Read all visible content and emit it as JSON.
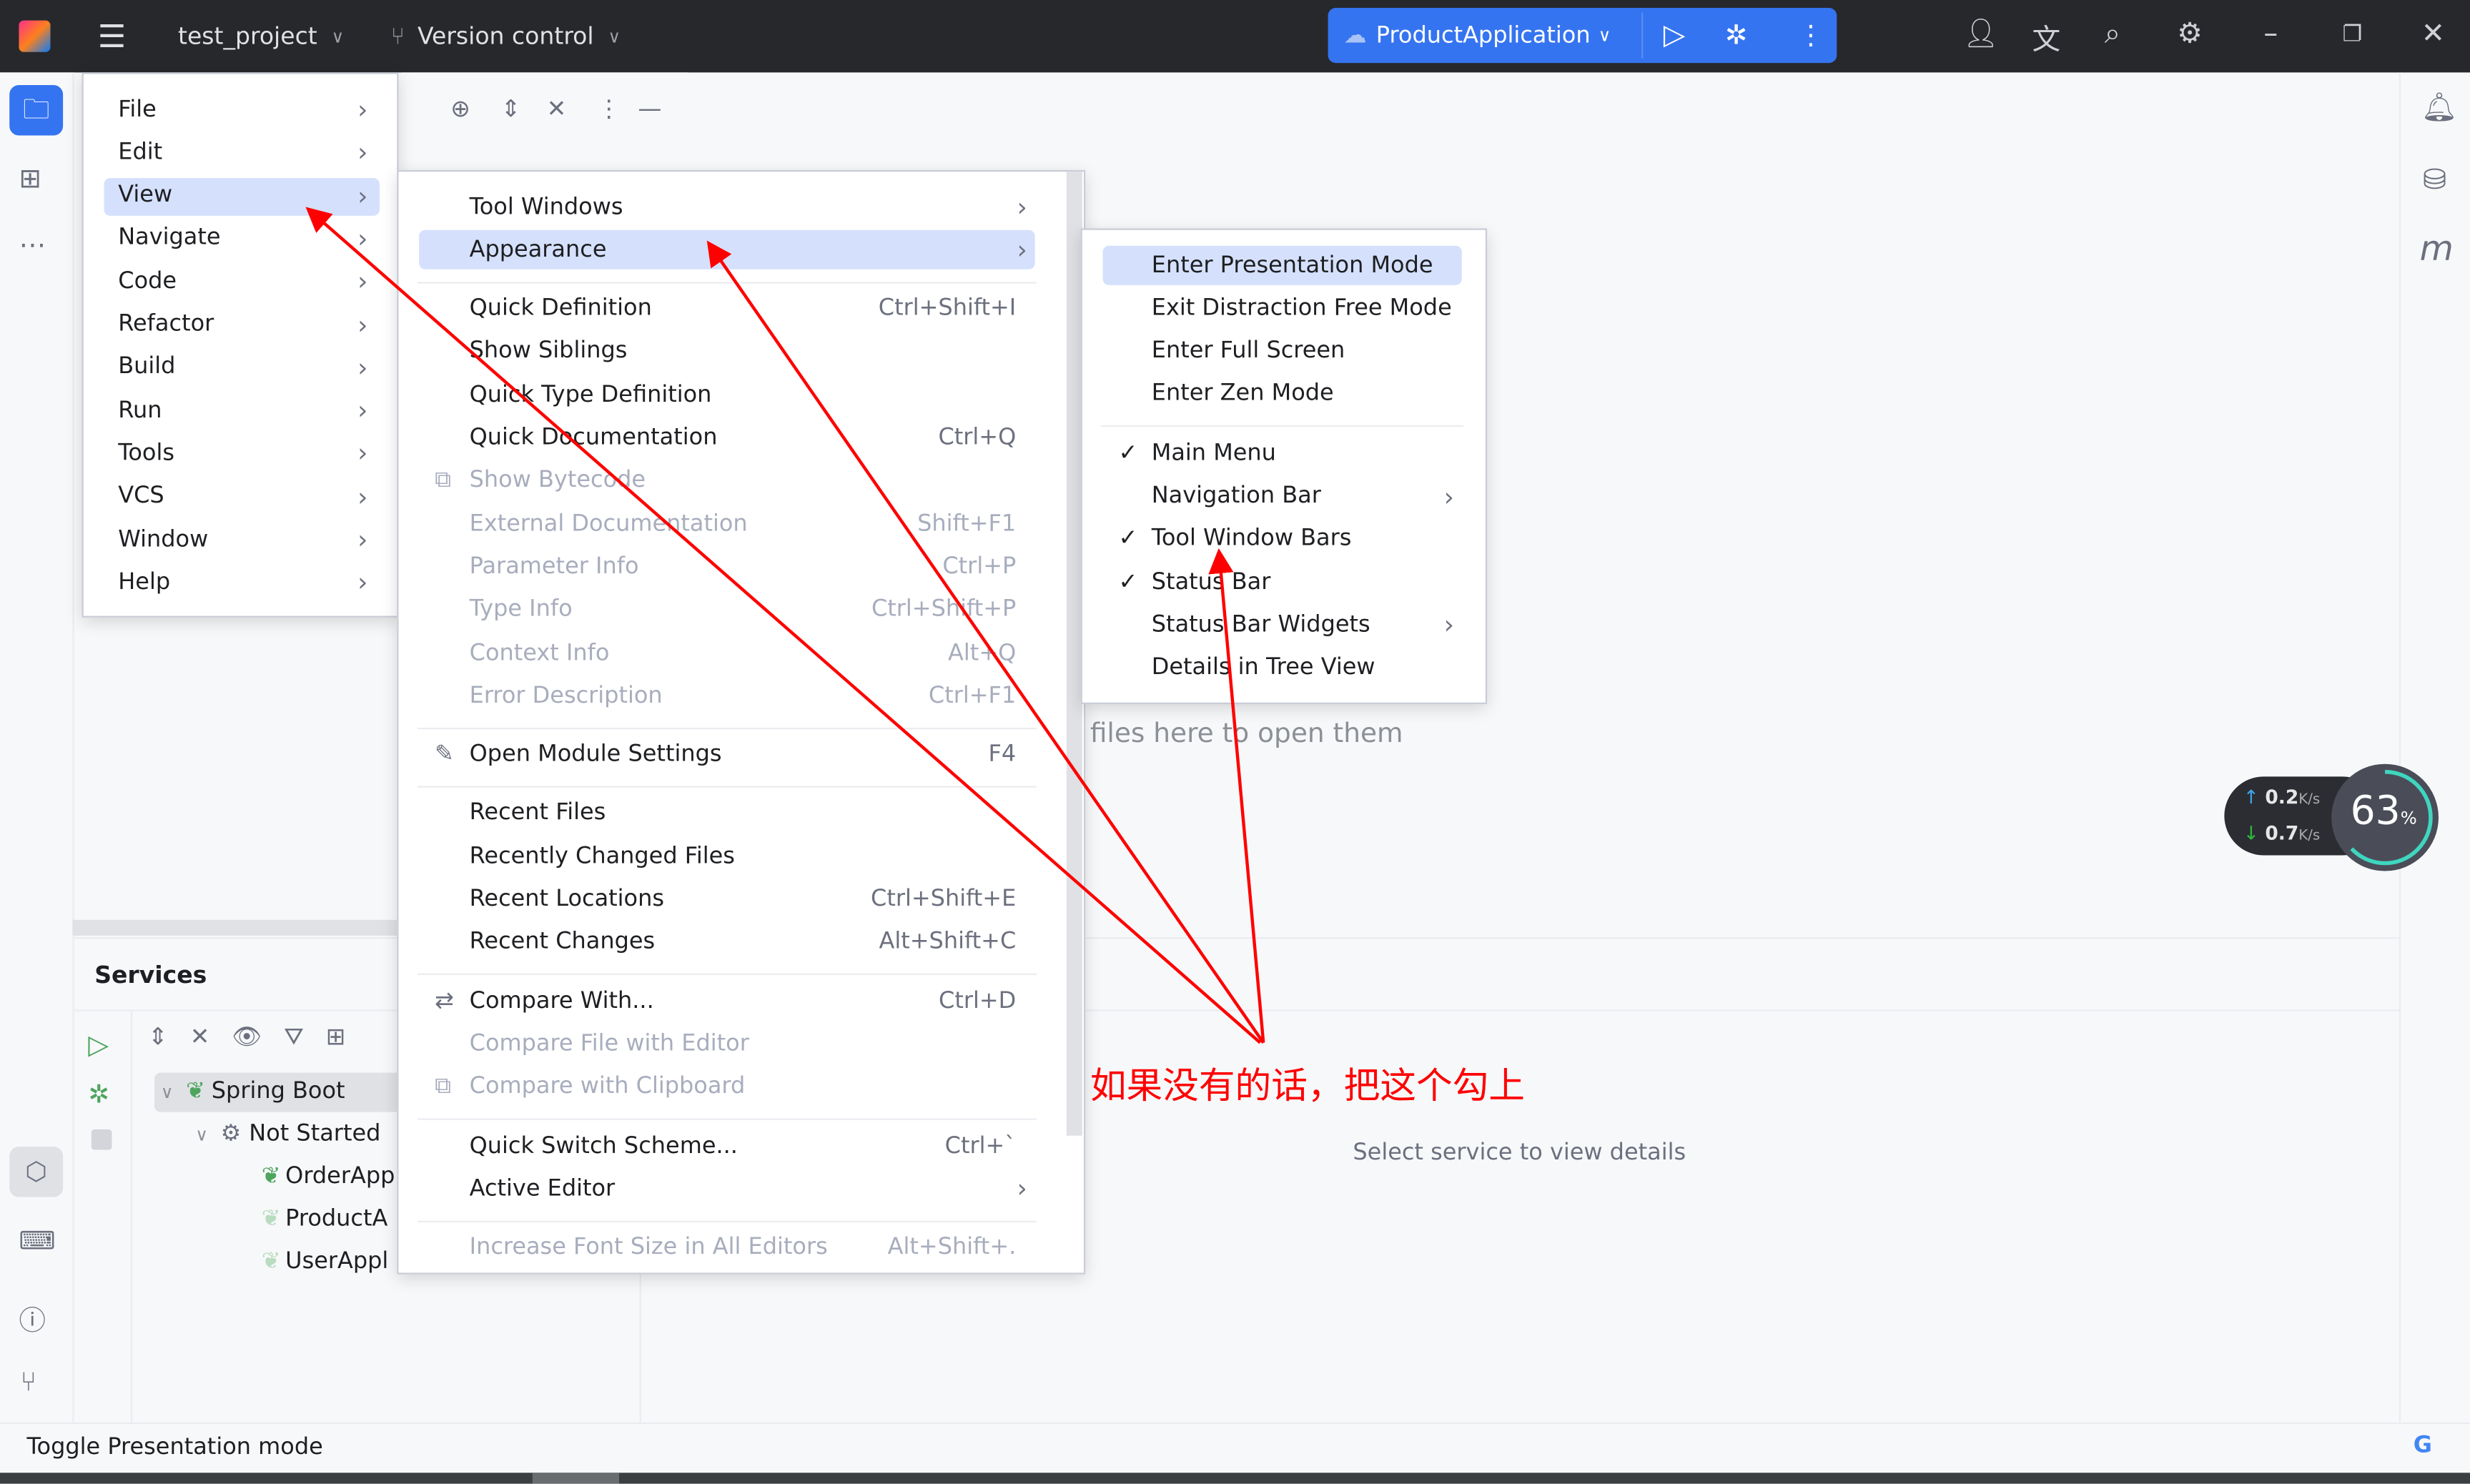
{
  "topbar": {
    "project": "test_project",
    "vcs": "Version control",
    "run_config": "ProductApplication"
  },
  "main_menu": [
    {
      "label": "File"
    },
    {
      "label": "Edit"
    },
    {
      "label": "View",
      "selected": true
    },
    {
      "label": "Navigate"
    },
    {
      "label": "Code"
    },
    {
      "label": "Refactor"
    },
    {
      "label": "Build"
    },
    {
      "label": "Run"
    },
    {
      "label": "Tools"
    },
    {
      "label": "VCS"
    },
    {
      "label": "Window"
    },
    {
      "label": "Help"
    }
  ],
  "view_menu": [
    {
      "label": "Tool Windows",
      "submenu": true
    },
    {
      "label": "Appearance",
      "submenu": true,
      "selected": true
    },
    {
      "sep": true
    },
    {
      "label": "Quick Definition",
      "shortcut": "Ctrl+Shift+I"
    },
    {
      "label": "Show Siblings"
    },
    {
      "label": "Quick Type Definition"
    },
    {
      "label": "Quick Documentation",
      "shortcut": "Ctrl+Q"
    },
    {
      "label": "Show Bytecode",
      "disabled": true,
      "icon": "bytecode-icon"
    },
    {
      "label": "External Documentation",
      "shortcut": "Shift+F1",
      "disabled": true
    },
    {
      "label": "Parameter Info",
      "shortcut": "Ctrl+P",
      "disabled": true
    },
    {
      "label": "Type Info",
      "shortcut": "Ctrl+Shift+P",
      "disabled": true
    },
    {
      "label": "Context Info",
      "shortcut": "Alt+Q",
      "disabled": true
    },
    {
      "label": "Error Description",
      "shortcut": "Ctrl+F1",
      "disabled": true
    },
    {
      "sep": true
    },
    {
      "label": "Open Module Settings",
      "shortcut": "F4",
      "icon": "pencil-icon"
    },
    {
      "sep": true
    },
    {
      "label": "Recent Files"
    },
    {
      "label": "Recently Changed Files"
    },
    {
      "label": "Recent Locations",
      "shortcut": "Ctrl+Shift+E"
    },
    {
      "label": "Recent Changes",
      "shortcut": "Alt+Shift+C"
    },
    {
      "sep": true
    },
    {
      "label": "Compare With...",
      "shortcut": "Ctrl+D",
      "icon": "compare-icon"
    },
    {
      "label": "Compare File with Editor",
      "disabled": true
    },
    {
      "label": "Compare with Clipboard",
      "disabled": true,
      "icon": "clipboard-compare-icon"
    },
    {
      "sep": true
    },
    {
      "label": "Quick Switch Scheme...",
      "shortcut": "Ctrl+`"
    },
    {
      "label": "Active Editor",
      "submenu": true
    },
    {
      "sep": true
    },
    {
      "label": "Increase Font Size in All Editors",
      "shortcut": "Alt+Shift+.",
      "disabled": true
    }
  ],
  "appearance_menu": [
    {
      "label": "Enter Presentation Mode",
      "selected": true
    },
    {
      "label": "Exit Distraction Free Mode"
    },
    {
      "label": "Enter Full Screen"
    },
    {
      "label": "Enter Zen Mode"
    },
    {
      "sep": true
    },
    {
      "label": "Main Menu",
      "checked": true
    },
    {
      "label": "Navigation Bar",
      "submenu": true
    },
    {
      "label": "Tool Window Bars",
      "checked": true
    },
    {
      "label": "Status Bar",
      "checked": true
    },
    {
      "label": "Status Bar Widgets",
      "submenu": true
    },
    {
      "label": "Details in Tree View"
    }
  ],
  "editor": {
    "empty_hint": "files here to open them"
  },
  "services": {
    "title": "Services",
    "tree": [
      {
        "label": "Spring Boot",
        "level": 0
      },
      {
        "label": "Not Started",
        "level": 1
      },
      {
        "label": "OrderApp",
        "level": 2
      },
      {
        "label": "ProductA",
        "level": 2
      },
      {
        "label": "UserAppl",
        "level": 2
      }
    ],
    "details_hint": "Select service to view details"
  },
  "annotation": {
    "text": "如果没有的话，把这个勾上",
    "color": "#ff0000"
  },
  "net_widget": {
    "upload": "0.2",
    "download": "0.7",
    "unit": "K/s",
    "percent": "63",
    "percent_sign": "%"
  },
  "statusbar": {
    "text": "Toggle Presentation mode"
  },
  "colors": {
    "accent": "#3574f0",
    "selection": "#d5e1fc",
    "topbar": "#27282c"
  }
}
